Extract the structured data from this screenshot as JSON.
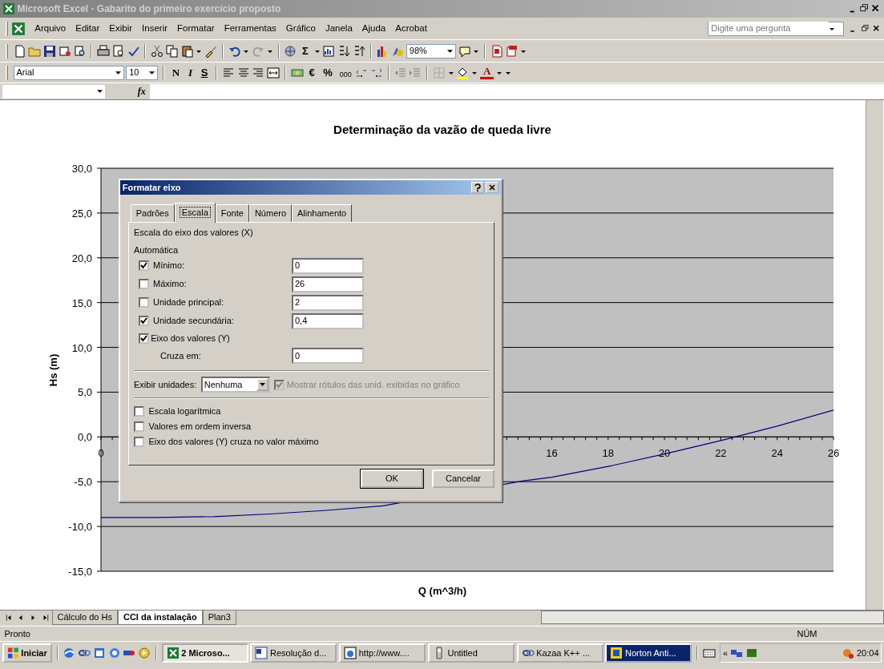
{
  "window": {
    "title": "Microsoft Excel - Gabarito do primeiro exercício proposto"
  },
  "menu": [
    "Arquivo",
    "Editar",
    "Exibir",
    "Inserir",
    "Formatar",
    "Ferramentas",
    "Gráfico",
    "Janela",
    "Ajuda",
    "Acrobat"
  ],
  "help_box": {
    "placeholder": "Digite uma pergunta"
  },
  "standard_toolbar": {
    "sum": "Σ",
    "zoom": "98%"
  },
  "formatting_toolbar": {
    "font": "Arial",
    "size": "10",
    "bold": "N",
    "italic": "I",
    "underline": "S",
    "euro": "€",
    "percent": "%",
    "thousands": "000",
    "font_color": "A"
  },
  "formula_bar": {
    "function_label": "fx"
  },
  "chart_data": {
    "type": "line",
    "title": "Determinação da vazão de queda livre",
    "xlabel": "Q (m^3/h)",
    "ylabel": "Hs (m)",
    "x": [
      0,
      2,
      4,
      6,
      8,
      10,
      15,
      16,
      18,
      20,
      22,
      24,
      26
    ],
    "series": [
      {
        "color": "#000080",
        "values": [
          -9.0,
          -9.0,
          -8.9,
          -8.6,
          -8.2,
          -7.7,
          -4.9,
          -4.5,
          -3.3,
          -1.9,
          -0.4,
          1.2,
          3.0
        ]
      }
    ],
    "grid": true,
    "xlim": [
      0,
      26
    ],
    "ylim": [
      -15,
      30
    ],
    "xticks": [
      0,
      16,
      18,
      20,
      22,
      24,
      26
    ],
    "yticks": [
      {
        "value": 30,
        "label": "30,0"
      },
      {
        "value": 25,
        "label": "25,0"
      },
      {
        "value": 20,
        "label": "20,0"
      },
      {
        "value": 15,
        "label": "15,0"
      },
      {
        "value": 10,
        "label": "10,0"
      },
      {
        "value": 5,
        "label": "5,0"
      },
      {
        "value": 0,
        "label": "0,0"
      },
      {
        "value": -5,
        "label": "-5,0"
      },
      {
        "value": -10,
        "label": "-10,0"
      },
      {
        "value": -15,
        "label": "-15,0"
      }
    ]
  },
  "dialog": {
    "title": "Formatar eixo",
    "tabs": [
      {
        "label": "Padrões",
        "selected": false
      },
      {
        "label": "Escala",
        "selected": true
      },
      {
        "label": "Fonte",
        "selected": false
      },
      {
        "label": "Número",
        "selected": false
      },
      {
        "label": "Alinhamento",
        "selected": false
      }
    ],
    "section": "Escala do eixo dos valores (X)",
    "group_label": "Automática",
    "fields": [
      {
        "label": "Mínimo:",
        "checked": true,
        "value": "0"
      },
      {
        "label": "Máximo:",
        "checked": false,
        "value": "26"
      },
      {
        "label": "Unidade principal:",
        "checked": false,
        "value": "2"
      },
      {
        "label": "Unidade secundária:",
        "checked": true,
        "value": "0,4"
      }
    ],
    "axis_check": {
      "label": "Eixo dos valores (Y)",
      "checked": true
    },
    "cross": {
      "label": "Cruza em:",
      "value": "0"
    },
    "display_units": {
      "label": "Exibir unidades:",
      "value": "Nenhuma"
    },
    "show_labels": {
      "label": "Mostrar rótulos das unid. exibidas no gráfico",
      "checked": true,
      "disabled": true
    },
    "options": [
      {
        "label": "Escala logarítmica",
        "checked": false
      },
      {
        "label": "Valores em ordem inversa",
        "checked": false
      },
      {
        "label": "Eixo dos valores (Y) cruza no valor máximo",
        "checked": false
      }
    ],
    "buttons": [
      "OK",
      "Cancelar"
    ]
  },
  "sheet_tabs": [
    {
      "label": "Cálculo do Hs",
      "selected": false
    },
    {
      "label": "CCI da instalação",
      "selected": true
    },
    {
      "label": "Plan3",
      "selected": false
    }
  ],
  "status_bar": {
    "left": "Pronto",
    "indicator": "NÚM"
  },
  "taskbar": {
    "start": "Iniciar",
    "buttons": [
      {
        "label": "2 Microso...",
        "selected": true,
        "highlighted": false
      },
      {
        "label": "Resolução d...",
        "selected": false,
        "highlighted": false
      },
      {
        "label": "http://www....",
        "selected": false,
        "highlighted": false
      },
      {
        "label": "Untitled",
        "selected": false,
        "highlighted": false
      },
      {
        "label": "Kazaa K++ ...",
        "selected": false,
        "highlighted": false
      },
      {
        "label": "Norton Anti...",
        "selected": false,
        "highlighted": true
      }
    ],
    "tray_expand": "«",
    "clock": "20:04"
  }
}
